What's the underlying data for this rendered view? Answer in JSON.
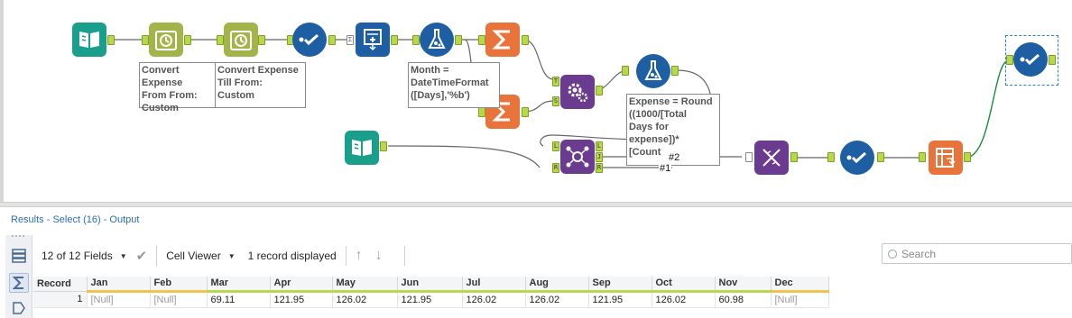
{
  "canvas": {
    "annotations": {
      "convert_from": "Convert Expense\nFrom From:\nCustom",
      "convert_till": "Convert Expense\nTill From:\nCustom",
      "month_formula": "Month =\nDateTimeFormat\n([Days],'%b')",
      "expense_formula": "Expense = Round\n((1000/[Total\nDays for\nexpense])*\n[Count"
    },
    "wire_labels": {
      "count_hash": "#2",
      "count_hash2": "#1"
    },
    "anchors": {
      "T": "T",
      "S": "S",
      "L": "L",
      "J": "J",
      "R": "R",
      "sum": "Σ"
    },
    "tools": [
      {
        "id": "input1",
        "icon": "book-icon",
        "color": "#1a9f8c"
      },
      {
        "id": "datetime1",
        "icon": "clock-icon",
        "color": "#a3b54a"
      },
      {
        "id": "datetime2",
        "icon": "clock-icon",
        "color": "#a3b54a"
      },
      {
        "id": "select1",
        "icon": "select-check-icon",
        "color": "#1e5fa3"
      },
      {
        "id": "generate-rows",
        "icon": "generate-rows-icon",
        "color": "#1e5fa3"
      },
      {
        "id": "formula1",
        "icon": "flask-icon",
        "color": "#1e5fa3"
      },
      {
        "id": "summarize1",
        "icon": "sigma-icon",
        "color": "#e8743b"
      },
      {
        "id": "summarize2",
        "icon": "sigma-icon",
        "color": "#e8743b"
      },
      {
        "id": "append-fields",
        "icon": "gears-icon",
        "color": "#6a3b8f"
      },
      {
        "id": "formula2",
        "icon": "flask-icon",
        "color": "#1e5fa3"
      },
      {
        "id": "input2",
        "icon": "book-icon",
        "color": "#1a9f8c"
      },
      {
        "id": "join",
        "icon": "join-icon",
        "color": "#6a3b8f"
      },
      {
        "id": "transpose",
        "icon": "dna-icon",
        "color": "#6a3b8f"
      },
      {
        "id": "select2",
        "icon": "select-check-icon",
        "color": "#1e5fa3"
      },
      {
        "id": "crosstab",
        "icon": "crosstab-icon",
        "color": "#e8743b"
      },
      {
        "id": "select16",
        "icon": "select-check-icon",
        "color": "#1e5fa3"
      }
    ]
  },
  "results": {
    "title": "Results - Select (16) - Output",
    "fields_label": "12 of 12 Fields",
    "viewer_label": "Cell Viewer",
    "records_label": "1 record displayed",
    "search_placeholder": "Search",
    "columns": [
      "Record",
      "Jan",
      "Feb",
      "Mar",
      "Apr",
      "May",
      "Jun",
      "Jul",
      "Aug",
      "Sep",
      "Oct",
      "Nov",
      "Dec"
    ],
    "rows": [
      [
        "1",
        "[Null]",
        "[Null]",
        "69.11",
        "121.95",
        "126.02",
        "121.95",
        "126.02",
        "126.02",
        "121.95",
        "126.02",
        "60.98",
        "[Null]"
      ]
    ]
  }
}
